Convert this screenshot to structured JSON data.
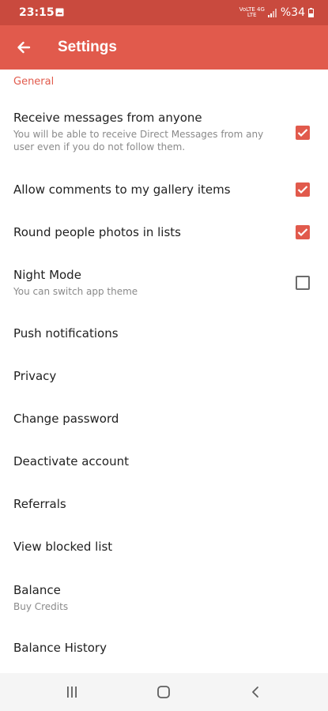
{
  "status_bar": {
    "time": "23:15",
    "network_top": "VoLTE 4G",
    "network_bottom": "LTE",
    "battery": "%34"
  },
  "app_bar": {
    "title": "Settings"
  },
  "section": {
    "general": "General"
  },
  "settings": [
    {
      "title": "Receive messages from anyone",
      "subtitle": "You will be able to receive Direct Messages from any user even if you do not follow them.",
      "checked": true
    },
    {
      "title": "Allow comments to my gallery items",
      "checked": true
    },
    {
      "title": "Round people photos in lists",
      "checked": true
    },
    {
      "title": "Night Mode",
      "subtitle": "You can switch app theme",
      "checked": false
    },
    {
      "title": "Push notifications"
    },
    {
      "title": "Privacy"
    },
    {
      "title": "Change password"
    },
    {
      "title": "Deactivate account"
    },
    {
      "title": "Referrals"
    },
    {
      "title": "View blocked list"
    },
    {
      "title": "Balance",
      "subtitle": "Buy Credits"
    },
    {
      "title": "Balance History"
    }
  ],
  "colors": {
    "status_bar": "#c94a3e",
    "app_bar": "#e15a4c",
    "accent": "#e15a4c"
  },
  "nav_bar": {
    "icons": [
      "recent-apps-icon",
      "home-icon",
      "back-icon"
    ]
  }
}
